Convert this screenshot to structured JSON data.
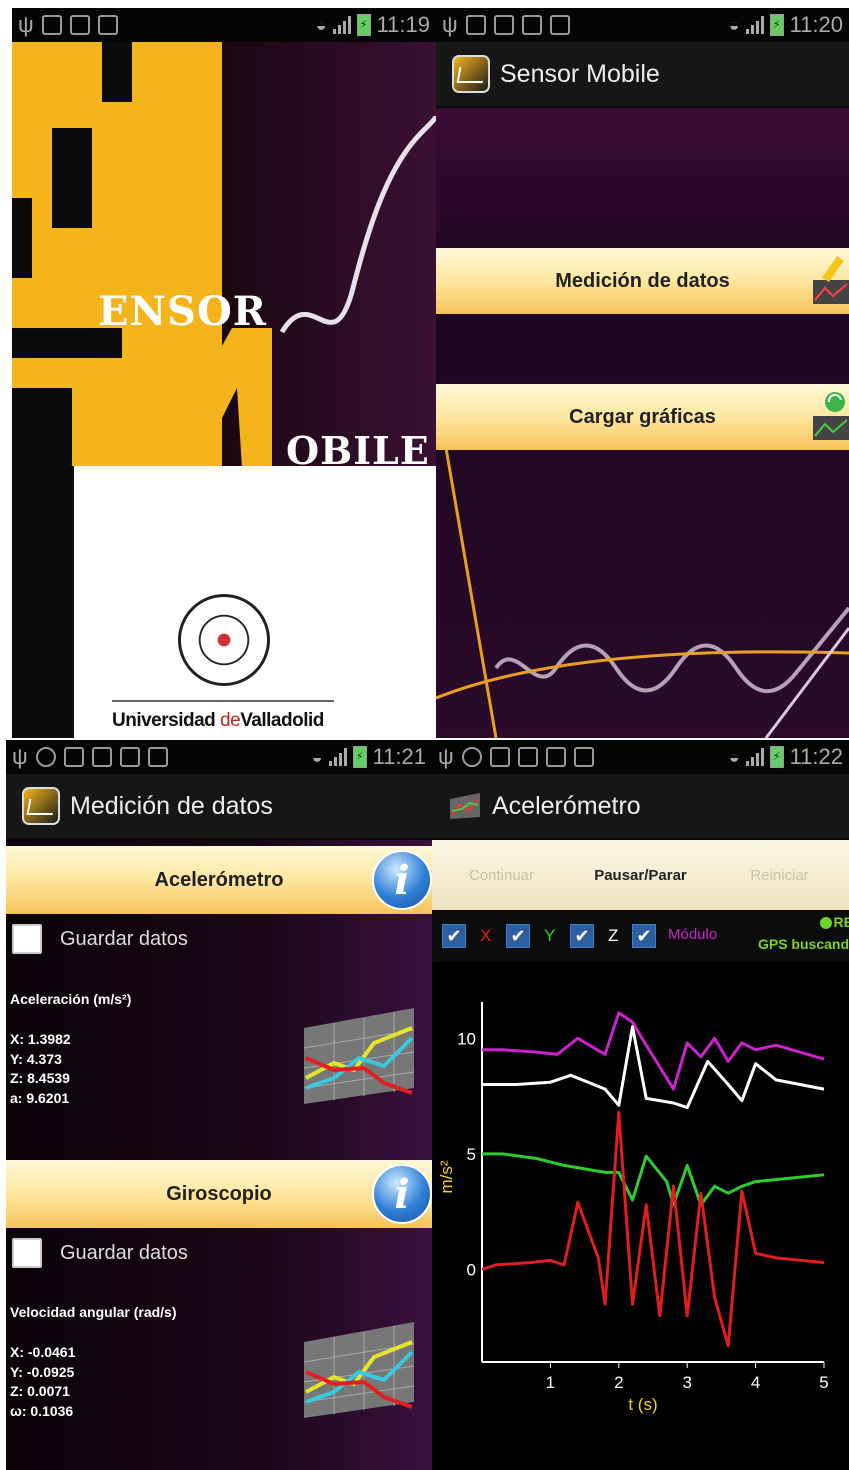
{
  "screens": [
    {
      "time": "11:19"
    },
    {
      "time": "11:20"
    },
    {
      "time": "11:21"
    },
    {
      "time": "11:22"
    }
  ],
  "splash": {
    "logo_top": "ENSOR",
    "logo_bottom": "OBILE",
    "university": {
      "part1": "Universidad ",
      "part2": "de",
      "part3": "Valladolid"
    }
  },
  "main_menu": {
    "app_title": "Sensor Mobile",
    "buttons": [
      "Medición de datos",
      "Cargar gráficas"
    ]
  },
  "measure": {
    "title": "Medición de datos",
    "sensors": [
      {
        "name": "Acelerómetro",
        "save_label": "Guardar datos",
        "section": "Aceleración (m/s²)",
        "values": [
          "X: 1.3982",
          "Y: 4.373",
          "Z: 8.4539",
          "a: 9.6201"
        ]
      },
      {
        "name": "Giroscopio",
        "save_label": "Guardar datos",
        "section": "Velocidad angular (rad/s)",
        "values": [
          "X: -0.0461",
          "Y: -0.0925",
          "Z: 0.0071",
          "ω: 0.1036"
        ]
      }
    ]
  },
  "accel": {
    "title": "Acelerómetro",
    "controls": [
      "Continuar",
      "Pausar/Parar",
      "Reiniciar"
    ],
    "series_toggles": [
      "X",
      "Y",
      "Z",
      "Módulo"
    ],
    "gps_top": "RE",
    "gps_status": "GPS buscand",
    "colors": {
      "x": "#e01e1e",
      "y": "#2ecc2e",
      "z": "#ffffff",
      "modulo": "#cc22cc",
      "axis": "#f4d21c"
    }
  },
  "chart_data": {
    "type": "line",
    "xlabel": "t (s)",
    "ylabel": "m/s²",
    "xlim": [
      0,
      5
    ],
    "ylim": [
      -4,
      12
    ],
    "xticks": [
      1,
      2,
      3,
      4,
      5
    ],
    "yticks": [
      0,
      5,
      10
    ],
    "series": [
      {
        "name": "Módulo",
        "color": "#cc22cc",
        "x": [
          0,
          0.3,
          0.8,
          1.1,
          1.4,
          1.8,
          2.0,
          2.2,
          2.4,
          2.8,
          3.0,
          3.2,
          3.4,
          3.6,
          3.8,
          4.0,
          4.3,
          5.0
        ],
        "y": [
          9.5,
          9.5,
          9.4,
          9.3,
          10.0,
          9.3,
          11.1,
          10.7,
          9.7,
          7.8,
          9.8,
          9.2,
          10.0,
          9.0,
          9.8,
          9.5,
          9.7,
          9.1
        ]
      },
      {
        "name": "Z",
        "color": "#ffffff",
        "x": [
          0,
          0.5,
          1.0,
          1.3,
          1.8,
          2.0,
          2.2,
          2.4,
          2.8,
          3.0,
          3.3,
          3.6,
          3.8,
          4.0,
          4.3,
          5.0
        ],
        "y": [
          8.0,
          8.0,
          8.1,
          8.4,
          7.8,
          7.1,
          10.5,
          7.4,
          7.2,
          7.0,
          9.0,
          8.0,
          7.3,
          8.9,
          8.2,
          7.8
        ]
      },
      {
        "name": "Y",
        "color": "#2ecc2e",
        "x": [
          0,
          0.3,
          0.8,
          1.2,
          1.8,
          2.0,
          2.2,
          2.4,
          2.7,
          2.8,
          3.0,
          3.2,
          3.4,
          3.6,
          3.8,
          4.0,
          5.0
        ],
        "y": [
          5.0,
          5.0,
          4.8,
          4.5,
          4.2,
          4.2,
          3.0,
          4.9,
          3.8,
          2.8,
          4.5,
          2.8,
          3.6,
          3.3,
          3.6,
          3.8,
          4.1
        ]
      },
      {
        "name": "X",
        "color": "#e01e1e",
        "x": [
          0,
          0.2,
          0.7,
          1.0,
          1.2,
          1.4,
          1.7,
          1.8,
          2.0,
          2.2,
          2.4,
          2.6,
          2.8,
          3.0,
          3.2,
          3.4,
          3.6,
          3.8,
          4.0,
          4.3,
          5.0
        ],
        "y": [
          0,
          0.2,
          0.3,
          0.4,
          0.2,
          2.9,
          0.5,
          -1.5,
          6.8,
          -1.5,
          2.8,
          -2.0,
          3.6,
          -2.0,
          3.3,
          -1.2,
          -3.3,
          3.4,
          0.7,
          0.5,
          0.3
        ]
      }
    ]
  }
}
